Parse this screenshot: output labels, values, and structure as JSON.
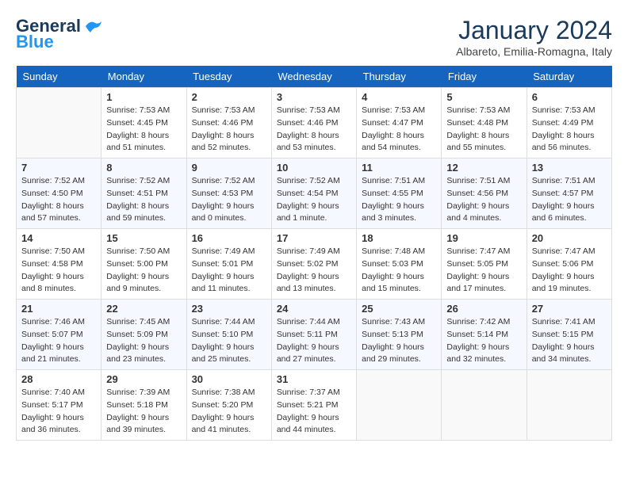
{
  "logo": {
    "text_general": "General",
    "text_blue": "Blue"
  },
  "header": {
    "month_year": "January 2024",
    "location": "Albareto, Emilia-Romagna, Italy"
  },
  "weekdays": [
    "Sunday",
    "Monday",
    "Tuesday",
    "Wednesday",
    "Thursday",
    "Friday",
    "Saturday"
  ],
  "weeks": [
    [
      {
        "day": "",
        "empty": true
      },
      {
        "day": "1",
        "sunrise": "Sunrise: 7:53 AM",
        "sunset": "Sunset: 4:45 PM",
        "daylight": "Daylight: 8 hours and 51 minutes."
      },
      {
        "day": "2",
        "sunrise": "Sunrise: 7:53 AM",
        "sunset": "Sunset: 4:46 PM",
        "daylight": "Daylight: 8 hours and 52 minutes."
      },
      {
        "day": "3",
        "sunrise": "Sunrise: 7:53 AM",
        "sunset": "Sunset: 4:46 PM",
        "daylight": "Daylight: 8 hours and 53 minutes."
      },
      {
        "day": "4",
        "sunrise": "Sunrise: 7:53 AM",
        "sunset": "Sunset: 4:47 PM",
        "daylight": "Daylight: 8 hours and 54 minutes."
      },
      {
        "day": "5",
        "sunrise": "Sunrise: 7:53 AM",
        "sunset": "Sunset: 4:48 PM",
        "daylight": "Daylight: 8 hours and 55 minutes."
      },
      {
        "day": "6",
        "sunrise": "Sunrise: 7:53 AM",
        "sunset": "Sunset: 4:49 PM",
        "daylight": "Daylight: 8 hours and 56 minutes."
      }
    ],
    [
      {
        "day": "7",
        "sunrise": "Sunrise: 7:52 AM",
        "sunset": "Sunset: 4:50 PM",
        "daylight": "Daylight: 8 hours and 57 minutes."
      },
      {
        "day": "8",
        "sunrise": "Sunrise: 7:52 AM",
        "sunset": "Sunset: 4:51 PM",
        "daylight": "Daylight: 8 hours and 59 minutes."
      },
      {
        "day": "9",
        "sunrise": "Sunrise: 7:52 AM",
        "sunset": "Sunset: 4:53 PM",
        "daylight": "Daylight: 9 hours and 0 minutes."
      },
      {
        "day": "10",
        "sunrise": "Sunrise: 7:52 AM",
        "sunset": "Sunset: 4:54 PM",
        "daylight": "Daylight: 9 hours and 1 minute."
      },
      {
        "day": "11",
        "sunrise": "Sunrise: 7:51 AM",
        "sunset": "Sunset: 4:55 PM",
        "daylight": "Daylight: 9 hours and 3 minutes."
      },
      {
        "day": "12",
        "sunrise": "Sunrise: 7:51 AM",
        "sunset": "Sunset: 4:56 PM",
        "daylight": "Daylight: 9 hours and 4 minutes."
      },
      {
        "day": "13",
        "sunrise": "Sunrise: 7:51 AM",
        "sunset": "Sunset: 4:57 PM",
        "daylight": "Daylight: 9 hours and 6 minutes."
      }
    ],
    [
      {
        "day": "14",
        "sunrise": "Sunrise: 7:50 AM",
        "sunset": "Sunset: 4:58 PM",
        "daylight": "Daylight: 9 hours and 8 minutes."
      },
      {
        "day": "15",
        "sunrise": "Sunrise: 7:50 AM",
        "sunset": "Sunset: 5:00 PM",
        "daylight": "Daylight: 9 hours and 9 minutes."
      },
      {
        "day": "16",
        "sunrise": "Sunrise: 7:49 AM",
        "sunset": "Sunset: 5:01 PM",
        "daylight": "Daylight: 9 hours and 11 minutes."
      },
      {
        "day": "17",
        "sunrise": "Sunrise: 7:49 AM",
        "sunset": "Sunset: 5:02 PM",
        "daylight": "Daylight: 9 hours and 13 minutes."
      },
      {
        "day": "18",
        "sunrise": "Sunrise: 7:48 AM",
        "sunset": "Sunset: 5:03 PM",
        "daylight": "Daylight: 9 hours and 15 minutes."
      },
      {
        "day": "19",
        "sunrise": "Sunrise: 7:47 AM",
        "sunset": "Sunset: 5:05 PM",
        "daylight": "Daylight: 9 hours and 17 minutes."
      },
      {
        "day": "20",
        "sunrise": "Sunrise: 7:47 AM",
        "sunset": "Sunset: 5:06 PM",
        "daylight": "Daylight: 9 hours and 19 minutes."
      }
    ],
    [
      {
        "day": "21",
        "sunrise": "Sunrise: 7:46 AM",
        "sunset": "Sunset: 5:07 PM",
        "daylight": "Daylight: 9 hours and 21 minutes."
      },
      {
        "day": "22",
        "sunrise": "Sunrise: 7:45 AM",
        "sunset": "Sunset: 5:09 PM",
        "daylight": "Daylight: 9 hours and 23 minutes."
      },
      {
        "day": "23",
        "sunrise": "Sunrise: 7:44 AM",
        "sunset": "Sunset: 5:10 PM",
        "daylight": "Daylight: 9 hours and 25 minutes."
      },
      {
        "day": "24",
        "sunrise": "Sunrise: 7:44 AM",
        "sunset": "Sunset: 5:11 PM",
        "daylight": "Daylight: 9 hours and 27 minutes."
      },
      {
        "day": "25",
        "sunrise": "Sunrise: 7:43 AM",
        "sunset": "Sunset: 5:13 PM",
        "daylight": "Daylight: 9 hours and 29 minutes."
      },
      {
        "day": "26",
        "sunrise": "Sunrise: 7:42 AM",
        "sunset": "Sunset: 5:14 PM",
        "daylight": "Daylight: 9 hours and 32 minutes."
      },
      {
        "day": "27",
        "sunrise": "Sunrise: 7:41 AM",
        "sunset": "Sunset: 5:15 PM",
        "daylight": "Daylight: 9 hours and 34 minutes."
      }
    ],
    [
      {
        "day": "28",
        "sunrise": "Sunrise: 7:40 AM",
        "sunset": "Sunset: 5:17 PM",
        "daylight": "Daylight: 9 hours and 36 minutes."
      },
      {
        "day": "29",
        "sunrise": "Sunrise: 7:39 AM",
        "sunset": "Sunset: 5:18 PM",
        "daylight": "Daylight: 9 hours and 39 minutes."
      },
      {
        "day": "30",
        "sunrise": "Sunrise: 7:38 AM",
        "sunset": "Sunset: 5:20 PM",
        "daylight": "Daylight: 9 hours and 41 minutes."
      },
      {
        "day": "31",
        "sunrise": "Sunrise: 7:37 AM",
        "sunset": "Sunset: 5:21 PM",
        "daylight": "Daylight: 9 hours and 44 minutes."
      },
      {
        "day": "",
        "empty": true
      },
      {
        "day": "",
        "empty": true
      },
      {
        "day": "",
        "empty": true
      }
    ]
  ]
}
